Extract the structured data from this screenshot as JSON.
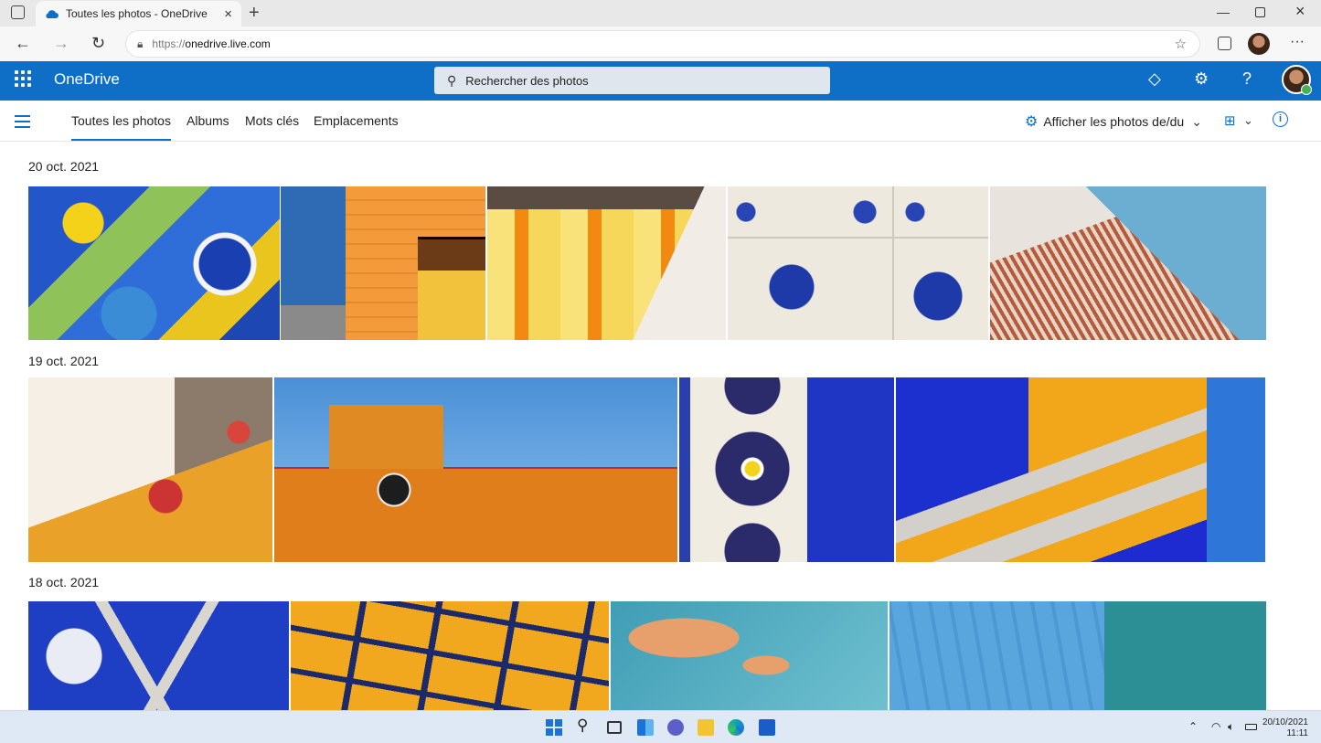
{
  "browser": {
    "tab_title": "Toutes les photos - OneDrive",
    "url_proto": "https://",
    "url_host": "onedrive.live.com"
  },
  "app": {
    "brand": "OneDrive",
    "search_placeholder": "Rechercher des photos"
  },
  "nav": {
    "tabs": [
      "Toutes les photos",
      "Albums",
      "Mots clés",
      "Emplacements"
    ],
    "active_tab": "Toutes les photos",
    "filter_label": "Afficher les photos de/du"
  },
  "groups": [
    {
      "date": "20 oct. 2021",
      "photos": [
        "mosaic-blue-yellow",
        "orange-wall-yellow-door",
        "yellow-orange-stripes",
        "white-blue-azulejo",
        "brick-red-blue-sky"
      ]
    },
    {
      "date": "19 oct. 2021",
      "photos": [
        "peeling-paint-red-orange",
        "orange-building-blue-sky",
        "navy-tile-blue-wall",
        "blue-yellow-stairs"
      ]
    },
    {
      "date": "18 oct. 2021",
      "photos": [
        "blue-white-mosaic",
        "yellow-tile-mosaic",
        "peeling-orange-turquoise",
        "blue-wood-planks"
      ]
    }
  ],
  "taskbar": {
    "date": "20/10/2021",
    "time": "11:11"
  },
  "colors": {
    "accent": "#0f6fc6",
    "search_bg": "#dfe6ee",
    "taskbar_bg": "#dfe9f5"
  }
}
